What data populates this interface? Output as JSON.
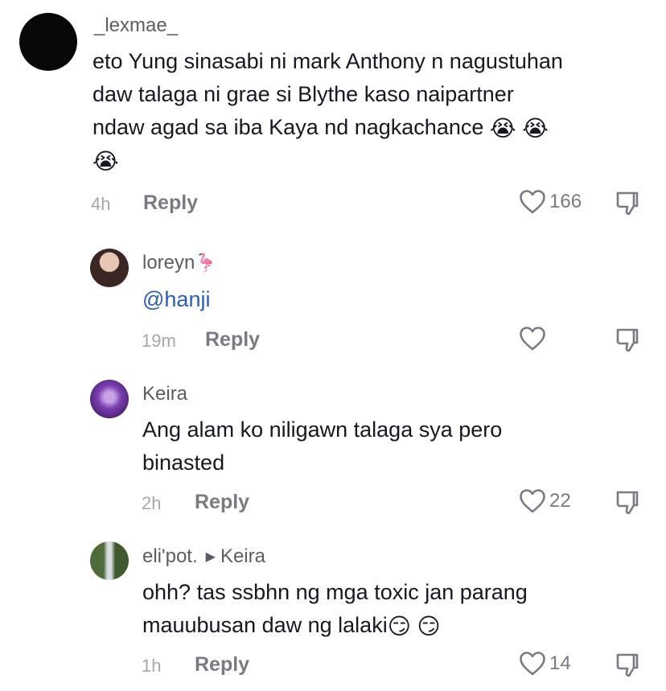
{
  "comments": [
    {
      "username": "_lexmae_",
      "line1": "eto Yung sinasabi ni mark Anthony n nagustuhan",
      "line2": "daw talaga ni grae si Blythe kaso naipartner",
      "line3": "ndaw agad sa iba Kaya nd nagkachance",
      "emojis": [
        "😭",
        "😭",
        "😭"
      ],
      "time": "4h",
      "reply_label": "Reply",
      "likes": "166"
    },
    {
      "username": "loreyn",
      "username_emoji": "🦩",
      "mention": "@hanji",
      "time": "19m",
      "reply_label": "Reply",
      "likes": ""
    },
    {
      "username": "Keira",
      "line1": "Ang alam ko niligawn talaga sya pero",
      "line2": "binasted",
      "time": "2h",
      "reply_label": "Reply",
      "likes": "22"
    },
    {
      "username": "eli'pot.",
      "reply_to": "Keira",
      "line1": "ohh? tas ssbhn ng mga toxic jan parang",
      "line2": "mauubusan daw ng lalaki",
      "emojis": [
        "😏",
        "😏"
      ],
      "time": "1h",
      "reply_label": "Reply",
      "likes": "14"
    }
  ],
  "colors": {
    "mention": "#2b5db9",
    "text": "#161823",
    "muted": "#a6a6ad"
  },
  "icons": {
    "like": "heart-outline-icon",
    "dislike": "thumbs-down-outline-icon",
    "reply_arrow": "play-triangle-icon"
  }
}
